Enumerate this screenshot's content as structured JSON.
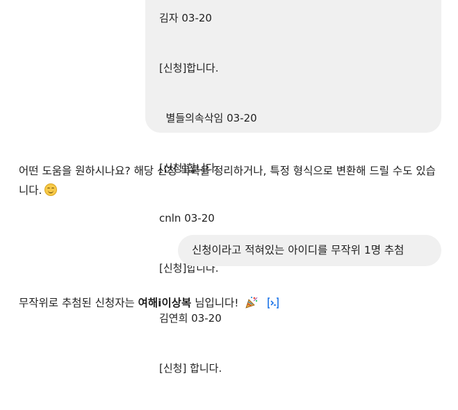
{
  "conversation": {
    "user_message_1": {
      "lines": [
        "김자 03-20",
        "[신청]합니다.",
        "  별들의속삭임 03-20",
        "[신청]합니다.",
        "cnln 03-20",
        "[신청]합니다.",
        "김연희 03-20",
        "[신청] 합니다."
      ]
    },
    "assistant_message_1": {
      "text": "어떤 도움을 원하시나요? 해당 신청 목록을 정리하거나, 특정 형식으로 변환해 드릴 수도 있습니다.",
      "emoji": "smiling-face-icon"
    },
    "user_message_2": {
      "text": "신청이라고 적혀있는 아이디를 무작위 1명 추첨"
    },
    "assistant_message_2": {
      "prefix": "무작위로 추첨된 신청자는 ",
      "winner": "여해i이상복",
      "suffix": " 님입니다!",
      "emoji": "party-popper-icon",
      "trailing_icon": "code-icon"
    }
  },
  "colors": {
    "user_bubble": "#f0f0f0",
    "text": "#1f1f1f",
    "code_icon": "#1a73e8"
  }
}
